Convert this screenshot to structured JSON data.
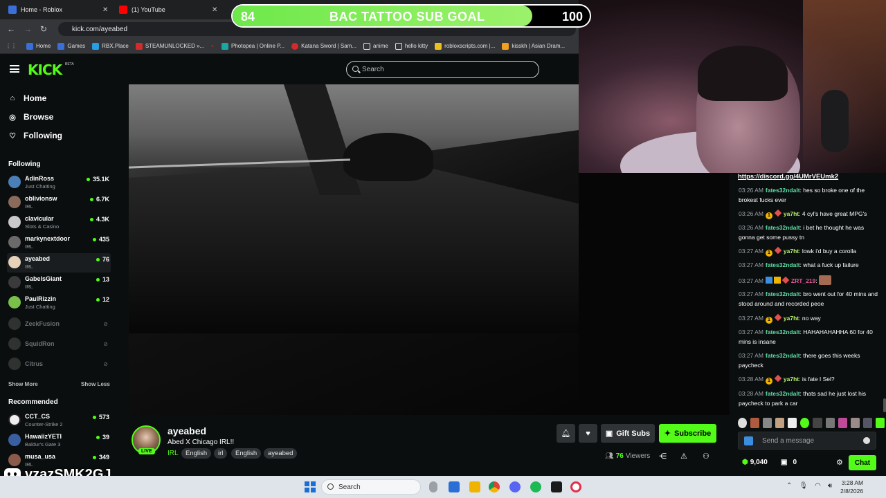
{
  "browser": {
    "tabs": [
      {
        "title": "Home - Roblox",
        "color": "#3b6fd8"
      },
      {
        "title": "(1) YouTube",
        "color": "#ff0000"
      }
    ],
    "url": "kick.com/ayeabed",
    "bookmarks": [
      "Home",
      "Games",
      "RBX.Place",
      "STEAMUNLOCKED »...",
      "Photopea | Online P...",
      "Katana Sword | Sam...",
      "anime",
      "hello kitty",
      "robloxscripts.com |...",
      "kisskh | Asian Dram..."
    ]
  },
  "goal": {
    "start": "84",
    "title": "BAC TATTOO SUB GOAL",
    "end": "100",
    "progress_fraction": 0.84
  },
  "kick": {
    "logo": "KICK",
    "beta": "BETA",
    "search_placeholder": "Search"
  },
  "sidebar": {
    "nav": [
      {
        "label": "Home",
        "icon": "home-icon"
      },
      {
        "label": "Browse",
        "icon": "compass-icon"
      },
      {
        "label": "Following",
        "icon": "heart-icon"
      }
    ],
    "following_title": "Following",
    "following": [
      {
        "name": "AdinRoss",
        "category": "Just Chatting",
        "viewers": "35.1K"
      },
      {
        "name": "oblivionsw",
        "category": "IRL",
        "viewers": "6.7K"
      },
      {
        "name": "clavicular",
        "category": "Slots & Casino",
        "viewers": "4.3K"
      },
      {
        "name": "markynextdoor",
        "category": "IRL",
        "viewers": "435"
      },
      {
        "name": "ayeabed",
        "category": "IRL",
        "viewers": "76"
      },
      {
        "name": "GabelsGiant",
        "category": "IRL",
        "viewers": "13"
      },
      {
        "name": "PaulRizzin",
        "category": "Just Chatting",
        "viewers": "12"
      }
    ],
    "offline": [
      "ZeekFusion",
      "SquidRon",
      "Citrus"
    ],
    "show_more": "Show More",
    "show_less": "Show Less",
    "recommended_title": "Recommended",
    "recommended": [
      {
        "name": "CCT_CS",
        "category": "Counter-Strike 2",
        "viewers": "573"
      },
      {
        "name": "HawaiizYETI",
        "category": "Baldur's Gate 3",
        "viewers": "39"
      },
      {
        "name": "musa_usa",
        "category": "IRL",
        "viewers": "349"
      }
    ]
  },
  "channel": {
    "name": "ayeabed",
    "live": "LIVE",
    "title": "Abed X Chicago IRL!!",
    "category": "IRL",
    "tags": [
      "English",
      "irl",
      "English",
      "ayeabed"
    ],
    "gift_subs": "Gift Subs",
    "subscribe": "Subscribe",
    "viewers": "76",
    "viewers_label": "Viewers"
  },
  "chat": {
    "pinned": "https://discord.gg/4UMrVEUmk2",
    "messages": [
      {
        "time": "03:26 AM",
        "user": "fates32ndalt",
        "color": "#5ee0a8",
        "badges": [],
        "text": "hes so broke one of the brokest fucks ever"
      },
      {
        "time": "03:26 AM",
        "user": "ya7ht",
        "color": "#b4f26b",
        "badges": [
          "b1",
          "b2"
        ],
        "text": "4 cyl's have great MPG's"
      },
      {
        "time": "03:26 AM",
        "user": "fates32ndalt",
        "color": "#5ee0a8",
        "badges": [],
        "text": "i bet he thought he was gonna get some pussy tn"
      },
      {
        "time": "03:27 AM",
        "user": "ya7ht",
        "color": "#b4f26b",
        "badges": [
          "b1",
          "b2"
        ],
        "text": "lowk i'd buy a corolla"
      },
      {
        "time": "03:27 AM",
        "user": "fates32ndalt",
        "color": "#5ee0a8",
        "badges": [],
        "text": "what a fuck up failure"
      },
      {
        "time": "03:27 AM",
        "user": "ZRT_219",
        "color": "#e05a9a",
        "badges": [
          "b3",
          "b4",
          "b2"
        ],
        "text": ""
      },
      {
        "time": "03:27 AM",
        "user": "fates32ndalt",
        "color": "#5ee0a8",
        "badges": [],
        "text": "bro went out for 40 mins and stood around and recorded peoe"
      },
      {
        "time": "03:27 AM",
        "user": "ya7ht",
        "color": "#b4f26b",
        "badges": [
          "b1",
          "b2"
        ],
        "text": "no way"
      },
      {
        "time": "03:27 AM",
        "user": "fates32ndalt",
        "color": "#5ee0a8",
        "badges": [],
        "text": "HAHAHAHAHHA 60 for 40 mins is insane"
      },
      {
        "time": "03:27 AM",
        "user": "fates32ndalt",
        "color": "#5ee0a8",
        "badges": [],
        "text": "there goes this weeks paycheck"
      },
      {
        "time": "03:28 AM",
        "user": "ya7ht",
        "color": "#b4f26b",
        "badges": [
          "b1",
          "b2"
        ],
        "text": "is fate I Sel?"
      },
      {
        "time": "03:28 AM",
        "user": "fates32ndalt",
        "color": "#5ee0a8",
        "badges": [],
        "text": "thats sad he just lost his paycheck to park a car"
      }
    ],
    "input_placeholder": "Send a message",
    "points": "9,040",
    "gifts": "0",
    "chat_button": "Chat"
  },
  "discord_overlay": {
    "handle": "vzazSMK2GJ"
  },
  "taskbar": {
    "search_placeholder": "Search",
    "time": "3:28 AM",
    "date": "2/8/2026"
  },
  "colors": {
    "kick_green": "#53fc18",
    "bg": "#0b0e0f"
  }
}
